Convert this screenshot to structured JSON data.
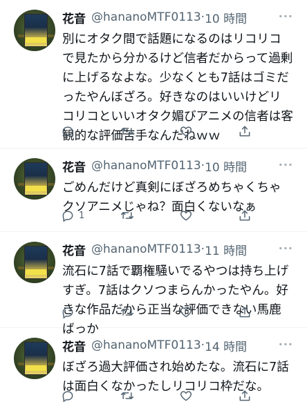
{
  "tweets": [
    {
      "name": "花音",
      "handle": "@hananoMTF0113",
      "dot": "·",
      "time": "10 時間",
      "more": "···",
      "text": "別にオタク間で話題になるのはリコリコで見たから分かるけど信者だからって過剰に上げるなよな。少なくとも7話はゴミだったやんぼざろ。好きなのはいいけどリコリコといいオタク媚びアニメの信者は客観的な評価苦手なんだねｗｗ",
      "reply_count": ""
    },
    {
      "name": "花音",
      "handle": "@hananoMTF0113",
      "dot": "·",
      "time": "10 時間",
      "more": "···",
      "text": "ごめんだけど真剣にぼざろめちゃくちゃクソアニメじゃね？面白くないなぁ",
      "reply_count": "1"
    },
    {
      "name": "花音",
      "handle": "@hananoMTF0113",
      "dot": "·",
      "time": "11 時間",
      "more": "···",
      "text": "流石に7話で覇権騒いでるやつは持ち上げすぎ。7話はクソつまらんかったやん。好きな作品だから正当な評価できない馬鹿ばっか",
      "reply_count": ""
    },
    {
      "name": "花音",
      "handle": "@hananoMTF0113",
      "dot": "·",
      "time": "14 時間",
      "more": "···",
      "text": "ぼざろ過大評価され始めたな。流石に7話は面白くなかったしリコリコ枠だな。",
      "reply_count": ""
    }
  ],
  "icons": [
    "reply-icon",
    "retweet-icon",
    "like-icon",
    "share-icon",
    "more-icon"
  ],
  "colors": {
    "text": "#0f1419",
    "secondary": "#536471",
    "divider": "#eff3f4"
  }
}
